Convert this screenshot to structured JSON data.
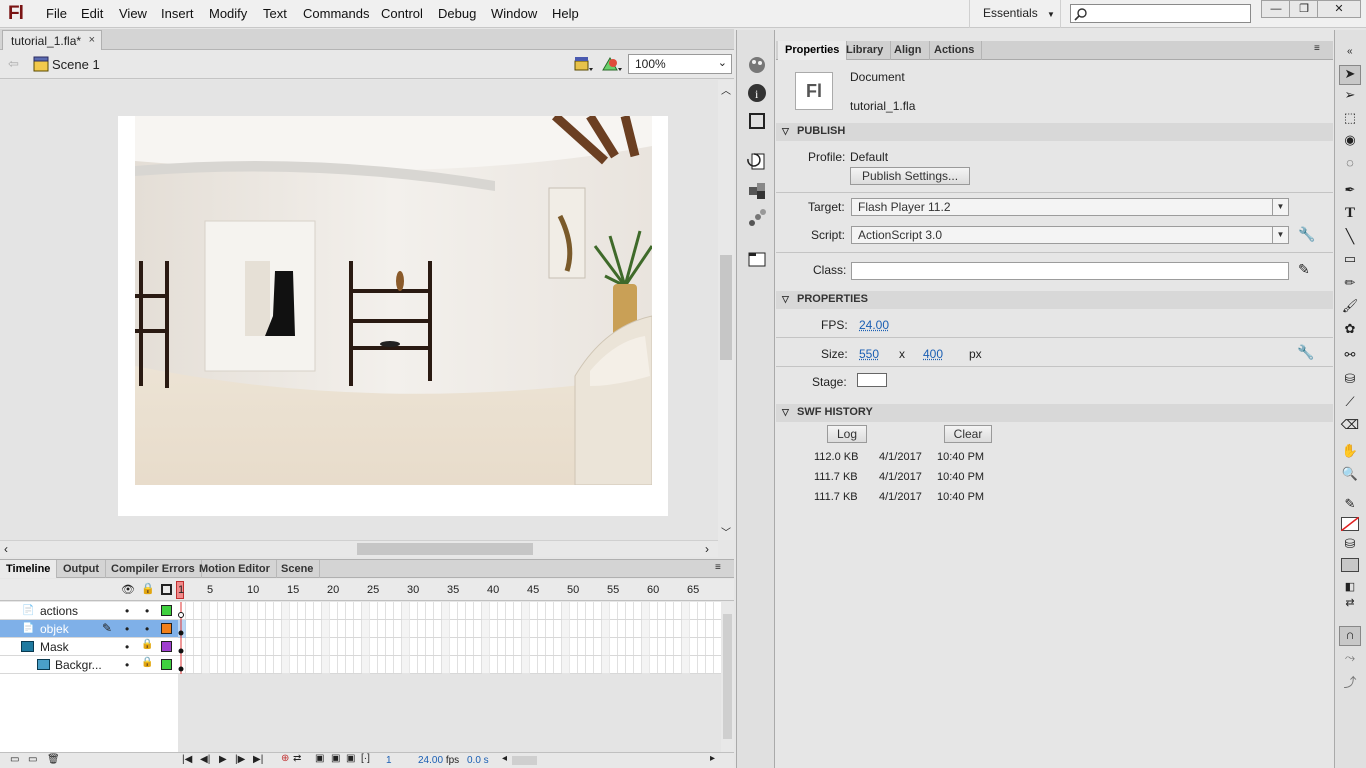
{
  "app": {
    "logo": "Fl"
  },
  "menu": [
    "File",
    "Edit",
    "View",
    "Insert",
    "Modify",
    "Text",
    "Commands",
    "Control",
    "Debug",
    "Window",
    "Help"
  ],
  "workspace": {
    "label": "Essentials"
  },
  "search": {
    "placeholder": ""
  },
  "window_controls": {
    "minimize": "—",
    "restore": "❐",
    "close": "✕"
  },
  "document": {
    "tab_label": "tutorial_1.fla*",
    "close": "×",
    "scene": "Scene 1",
    "zoom": "100%"
  },
  "timeline": {
    "tabs": [
      "Timeline",
      "Output",
      "Compiler Errors",
      "Motion Editor",
      "Scene"
    ],
    "frame_numbers": [
      "1",
      "5",
      "10",
      "15",
      "20",
      "25",
      "30",
      "35",
      "40",
      "45",
      "50",
      "55",
      "60",
      "65"
    ],
    "layers": [
      {
        "name": "actions",
        "color": "#3fd03f"
      },
      {
        "name": "objek",
        "color": "#f07f1a"
      },
      {
        "name": "Mask",
        "color": "#a040d0"
      },
      {
        "name": "Backgr...",
        "color": "#3fd03f"
      }
    ],
    "status": {
      "current_frame": "1",
      "fps": "24.00",
      "fps_unit": "fps",
      "time": "0.0 s"
    }
  },
  "panel": {
    "tabs": [
      "Properties",
      "Library",
      "Align",
      "Actions"
    ],
    "doc_type": "Document",
    "doc_name": "tutorial_1.fla",
    "publish": {
      "header": "PUBLISH",
      "profile_label": "Profile:",
      "profile_value": "Default",
      "settings_button": "Publish Settings...",
      "target_label": "Target:",
      "target_value": "Flash Player 11.2",
      "script_label": "Script:",
      "script_value": "ActionScript 3.0",
      "class_label": "Class:",
      "class_value": ""
    },
    "properties": {
      "header": "PROPERTIES",
      "fps_label": "FPS:",
      "fps_value": "24.00",
      "size_label": "Size:",
      "width": "550",
      "x_sep": "x",
      "height": "400",
      "unit": "px",
      "stage_label": "Stage:",
      "stage_color": "#ffffff"
    },
    "swf_history": {
      "header": "SWF HISTORY",
      "log_button": "Log",
      "clear_button": "Clear",
      "entries": [
        {
          "size": "112.0 KB",
          "date": "4/1/2017",
          "time": "10:40 PM"
        },
        {
          "size": "111.7 KB",
          "date": "4/1/2017",
          "time": "10:40 PM"
        },
        {
          "size": "111.7 KB",
          "date": "4/1/2017",
          "time": "10:40 PM"
        }
      ]
    }
  },
  "tools": [
    "selection",
    "subselection",
    "free-transform",
    "3d-rotation",
    "lasso",
    "pen",
    "text",
    "line",
    "rectangle",
    "pencil",
    "brush",
    "deco",
    "bone",
    "paint-bucket",
    "eyedropper",
    "eraser",
    "hand",
    "zoom",
    "stroke-color",
    "fill-color",
    "swap-colors",
    "snap",
    "smooth",
    "straighten"
  ]
}
